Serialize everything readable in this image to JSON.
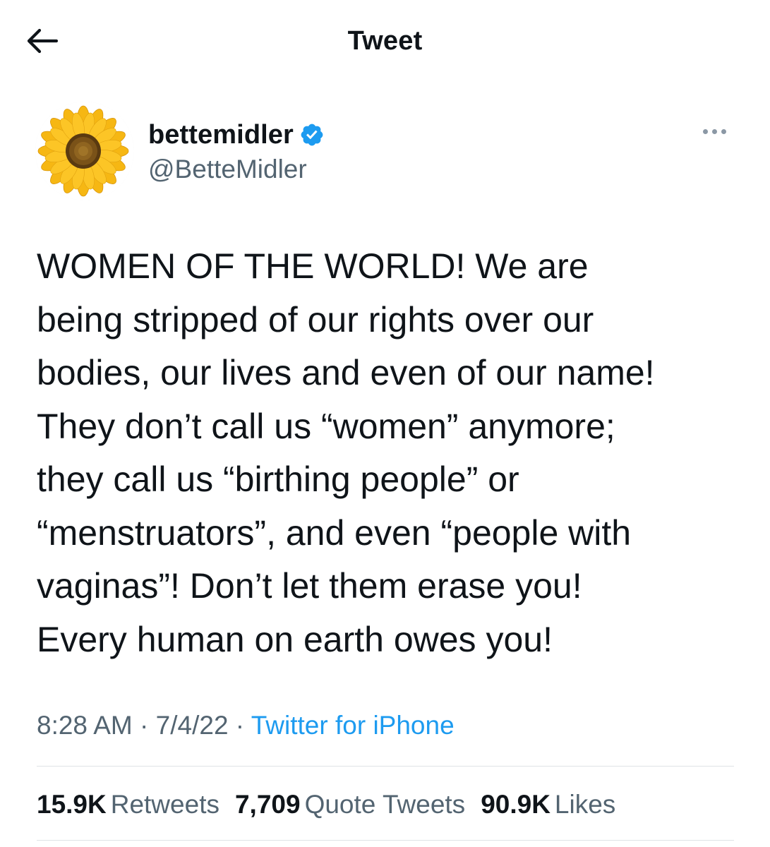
{
  "header": {
    "title": "Tweet",
    "back_icon": "arrow-left-icon"
  },
  "author": {
    "display_name": "bettemidler",
    "handle": "@BetteMidler",
    "verified": true,
    "verified_icon": "verified-badge-icon",
    "avatar": "sunflower-avatar",
    "more_icon": "more-horizontal-icon"
  },
  "tweet": {
    "text": "WOMEN OF THE WORLD! We are\nbeing stripped of our rights over our\nbodies, our lives and even of our name!\nThey don’t call us “women” anymore;\nthey call us “birthing people” or\n“menstruators”, and even “people with\nvaginas”!  Don’t let them erase you!\nEvery human on earth owes you!",
    "time": "8:28 AM",
    "separator": " · ",
    "date": "7/4/22",
    "source": "Twitter for iPhone"
  },
  "stats": {
    "retweets_count": "15.9K",
    "retweets_label": "Retweets",
    "quotes_count": "7,709",
    "quotes_label": "Quote Tweets",
    "likes_count": "90.9K",
    "likes_label": "Likes"
  },
  "colors": {
    "text": "#0f1419",
    "secondary": "#536471",
    "accent": "#1d9bf0",
    "divider": "#dfe3e6"
  }
}
